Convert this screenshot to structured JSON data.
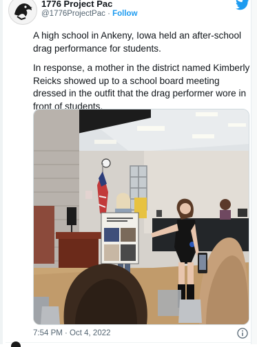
{
  "account": {
    "name": "1776 Project Pac",
    "handle": "@1776ProjectPac",
    "separator": "·",
    "follow_label": "Follow"
  },
  "tweet": {
    "paragraph_1": "A high school in Ankeny, Iowa held an after-school drag performance for students.",
    "paragraph_2": "In response, a mother in the district named Kimberly Reicks showed up to a school board meeting dressed in the outfit that the drag performer wore in front of students."
  },
  "meta": {
    "timestamp": "7:54 PM · Oct 4, 2022"
  },
  "icons": {
    "brand": "twitter-bird-icon",
    "info": "info-icon",
    "avatar": "eagle-logo-icon"
  },
  "colors": {
    "accent": "#1d9bf0",
    "text": "#0f1419",
    "secondary": "#536471"
  }
}
